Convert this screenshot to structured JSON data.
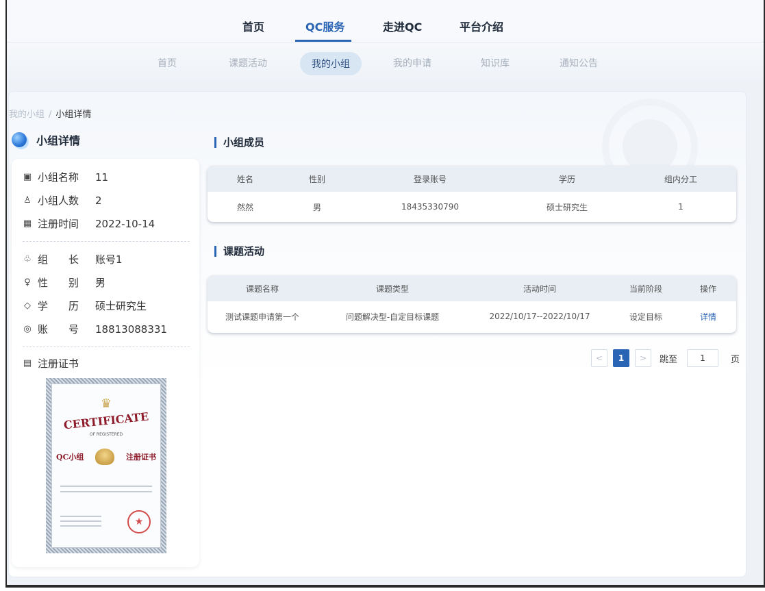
{
  "top_nav": {
    "items": [
      {
        "label": "首页"
      },
      {
        "label": "QC服务"
      },
      {
        "label": "走进QC"
      },
      {
        "label": "平台介绍"
      }
    ],
    "active": "QC服务"
  },
  "sub_nav": {
    "items": [
      {
        "label": "首页"
      },
      {
        "label": "课题活动"
      },
      {
        "label": "我的小组"
      },
      {
        "label": "我的申请"
      },
      {
        "label": "知识库"
      },
      {
        "label": "通知公告"
      }
    ],
    "active": "我的小组"
  },
  "breadcrumb": {
    "parent": "我的小组",
    "separator": "/",
    "current": "小组详情"
  },
  "group_panel": {
    "title": "小组详情",
    "fields": [
      {
        "icon": "id-card-icon",
        "label": "小组名称",
        "value": "11"
      },
      {
        "icon": "users-icon",
        "label": "小组人数",
        "value": "2"
      },
      {
        "icon": "calendar-icon",
        "label": "注册时间",
        "value": "2022-10-14"
      },
      {
        "icon": "leader-icon",
        "label": "组　　长",
        "value": "账号1"
      },
      {
        "icon": "person-icon",
        "label": "性　　别",
        "value": "男"
      },
      {
        "icon": "graduation-cap-icon",
        "label": "学　　历",
        "value": "硕士研究生"
      },
      {
        "icon": "account-icon",
        "label": "账　　号",
        "value": "18813088331"
      }
    ],
    "certificate_label": "注册证书",
    "certificate": {
      "title": "CERTIFICATE",
      "subtitle": "OF REGISTERED",
      "left": "QC小组",
      "right": "注册证书"
    }
  },
  "members": {
    "title": "小组成员",
    "columns": [
      "姓名",
      "性别",
      "登录账号",
      "学历",
      "组内分工"
    ],
    "rows": [
      [
        "然然",
        "男",
        "18435330790",
        "硕士研究生",
        "1"
      ]
    ]
  },
  "activities": {
    "title": "课题活动",
    "columns": [
      "课题名称",
      "课题类型",
      "活动时间",
      "当前阶段",
      "操作"
    ],
    "rows": [
      [
        "测试课题申请第一个",
        "问题解决型-自定目标课题",
        "2022/10/17--2022/10/17",
        "设定目标",
        "详情"
      ]
    ]
  },
  "pagination": {
    "prev": "<",
    "current": "1",
    "next": ">",
    "jump_label": "跳至",
    "jump_value": "1",
    "page_suffix": "页"
  },
  "colors": {
    "accent": "#2a64b4",
    "seal": "#d24a4a",
    "certificate_title": "#8e1b2a"
  }
}
